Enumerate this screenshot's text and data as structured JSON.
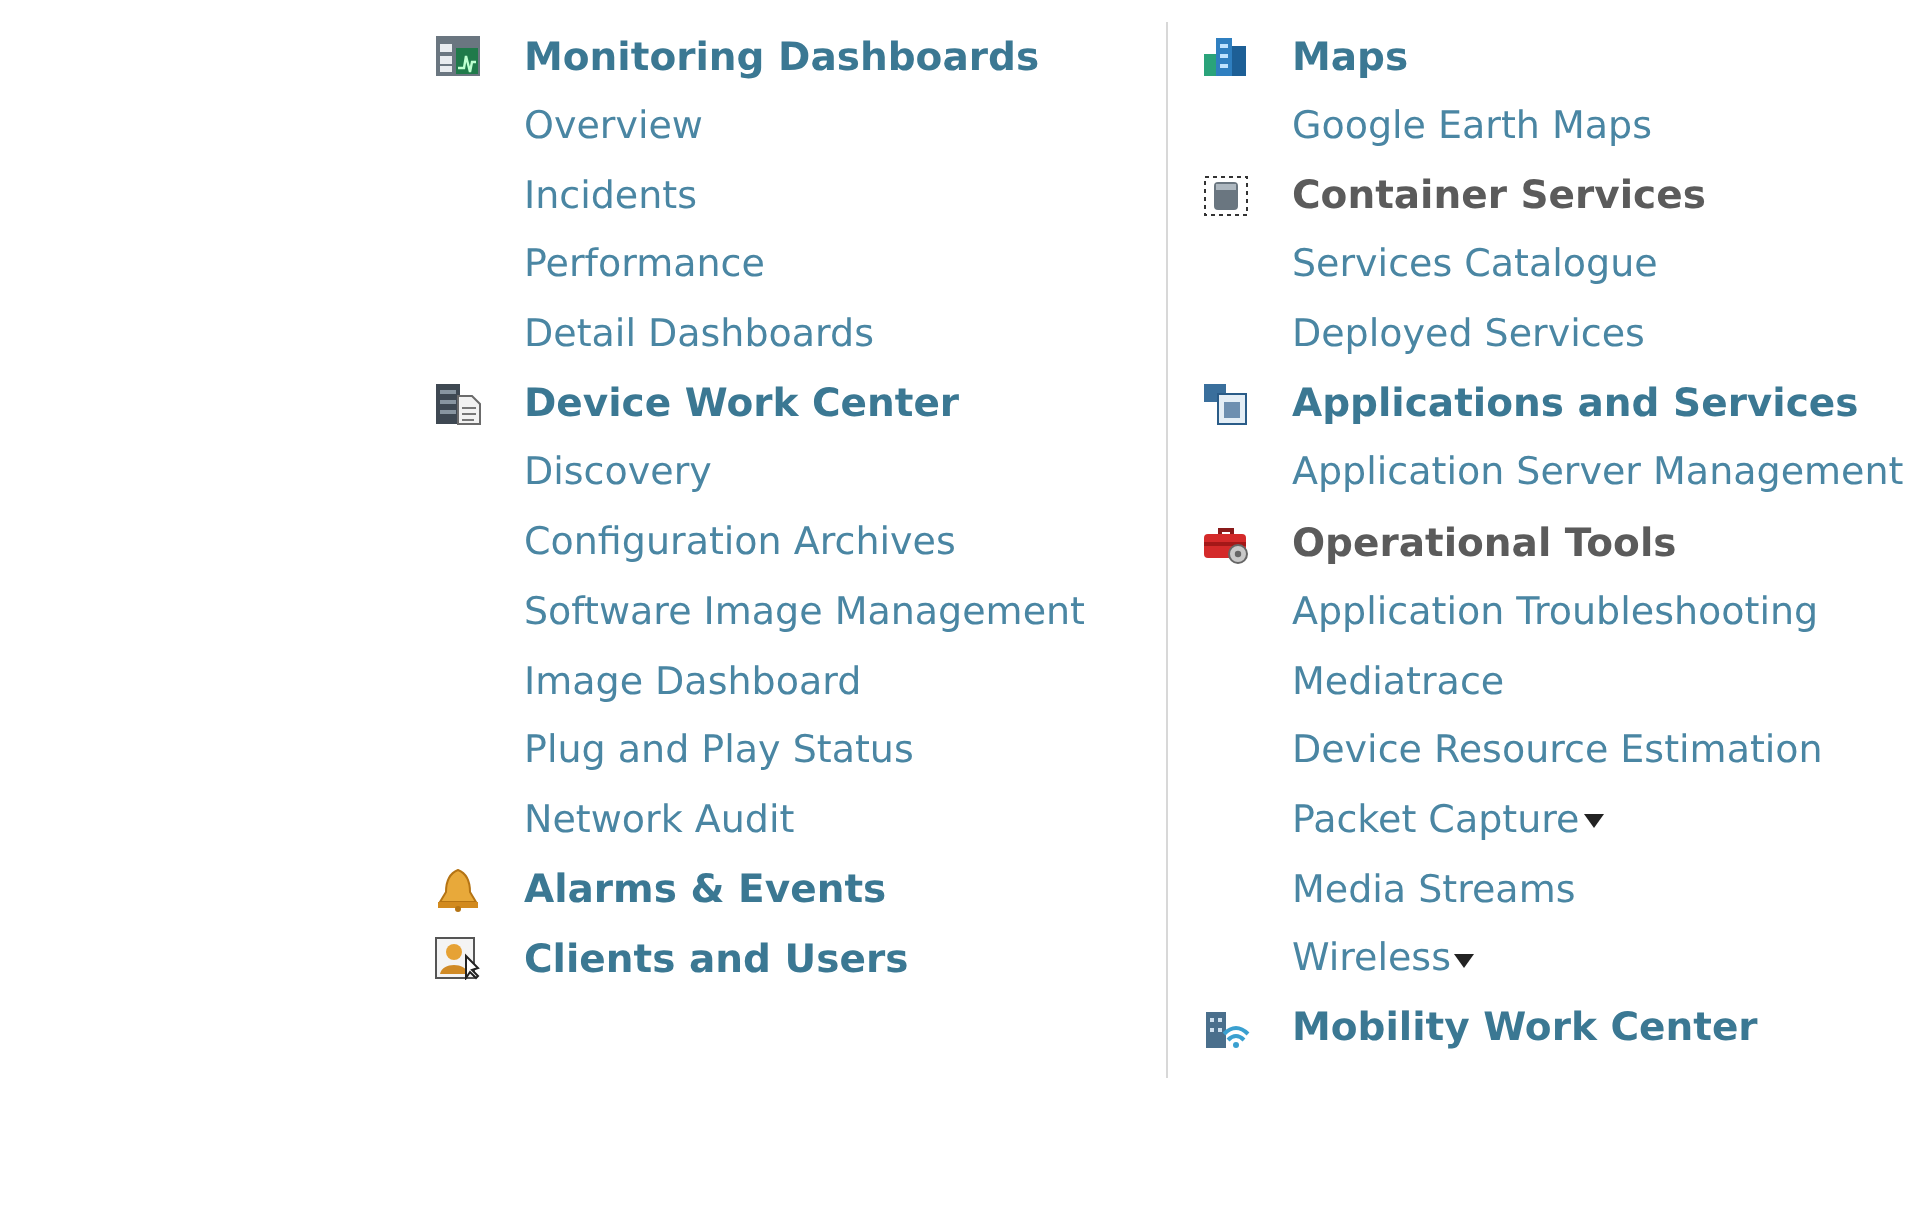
{
  "columns": [
    {
      "sections": [
        {
          "title": "Monitoring Dashboards",
          "color": "#3b7893",
          "items": [
            {
              "label": "Overview",
              "has_submenu": false
            },
            {
              "label": "Incidents",
              "has_submenu": false
            },
            {
              "label": "Performance",
              "has_submenu": false
            },
            {
              "label": "Detail Dashboards",
              "has_submenu": false
            }
          ]
        },
        {
          "title": "Device Work Center",
          "color": "#3b7893",
          "items": [
            {
              "label": "Discovery",
              "has_submenu": false
            },
            {
              "label": "Configuration Archives",
              "has_submenu": false
            },
            {
              "label": "Software Image Management",
              "has_submenu": false
            },
            {
              "label": "Image Dashboard",
              "has_submenu": false
            },
            {
              "label": "Plug and Play Status",
              "has_submenu": false
            },
            {
              "label": "Network Audit",
              "has_submenu": false
            }
          ]
        },
        {
          "title": "Alarms & Events",
          "color": "#3b7893"
        },
        {
          "title": "Clients and Users",
          "color": "#3b7893"
        }
      ]
    },
    {
      "sections": [
        {
          "title": "Maps",
          "color": "#3b7893",
          "items": [
            {
              "label": "Google Earth Maps",
              "has_submenu": false
            }
          ]
        },
        {
          "title": "Container Services",
          "color": "#5b5b5b",
          "items": [
            {
              "label": "Services Catalogue",
              "has_submenu": false
            },
            {
              "label": "Deployed Services",
              "has_submenu": false
            }
          ]
        },
        {
          "title": "Applications and Services",
          "color": "#3b7893",
          "items": [
            {
              "label": "Application Server Management",
              "has_submenu": false
            }
          ]
        },
        {
          "title": "Operational Tools",
          "color": "#5b5b5b",
          "items": [
            {
              "label": "Application Troubleshooting",
              "has_submenu": false
            },
            {
              "label": "Mediatrace",
              "has_submenu": false
            },
            {
              "label": "Device Resource Estimation",
              "has_submenu": false
            },
            {
              "label": "Packet Capture",
              "has_submenu": true
            },
            {
              "label": "Media Streams",
              "has_submenu": false
            },
            {
              "label": "Wireless",
              "has_submenu": true
            }
          ]
        },
        {
          "title": "Mobility Work Center",
          "color": "#3b7893"
        }
      ]
    }
  ]
}
